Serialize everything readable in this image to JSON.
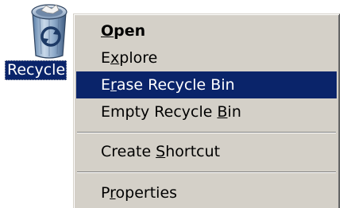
{
  "desktop": {
    "icon": {
      "name": "recycle-bin-icon",
      "label": "Recycle"
    }
  },
  "context_menu": {
    "items": [
      {
        "pre": "",
        "mnemonic": "O",
        "post": "pen",
        "default": true,
        "highlighted": false
      },
      {
        "pre": "E",
        "mnemonic": "x",
        "post": "plore",
        "default": false,
        "highlighted": false
      },
      {
        "pre": "E",
        "mnemonic": "r",
        "post": "ase Recycle Bin",
        "default": false,
        "highlighted": true
      },
      {
        "pre": "Empty Recycle ",
        "mnemonic": "B",
        "post": "in",
        "default": false,
        "highlighted": false
      },
      {
        "pre": "Create ",
        "mnemonic": "S",
        "post": "hortcut",
        "default": false,
        "highlighted": false
      },
      {
        "pre": "P",
        "mnemonic": "r",
        "post": "operties",
        "default": false,
        "highlighted": false
      }
    ]
  },
  "colors": {
    "menu_background": "#d4d0c8",
    "selection": "#0a246a",
    "selection_text": "#ffffff"
  }
}
